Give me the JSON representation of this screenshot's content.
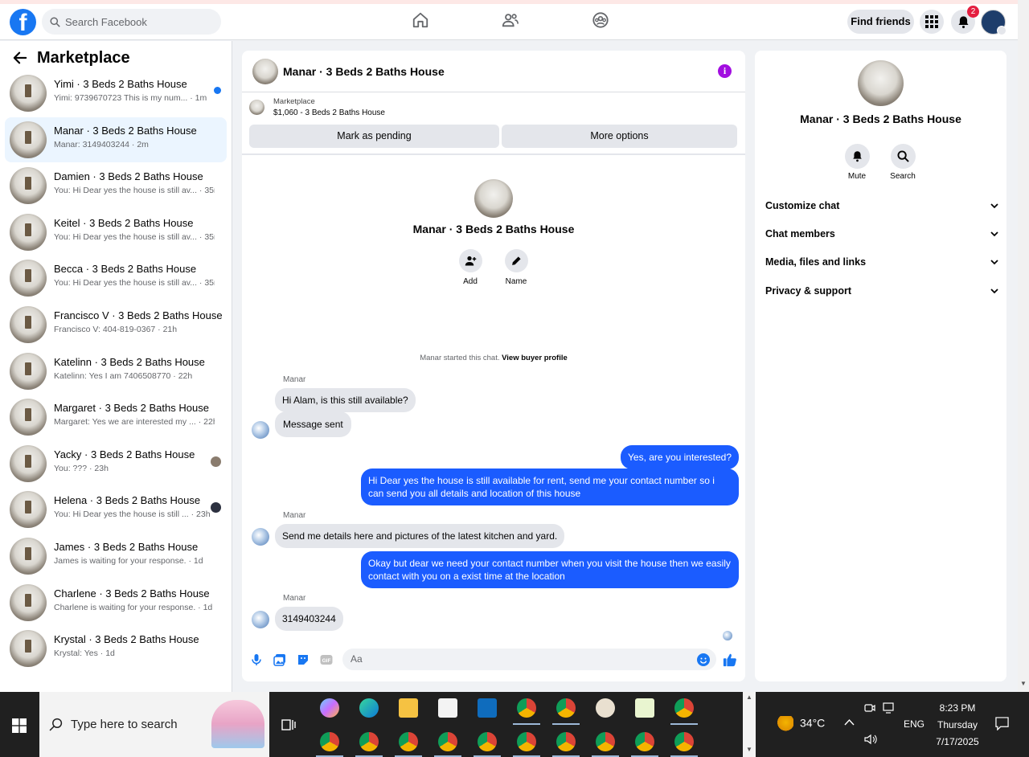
{
  "topbar": {
    "logo_letter": "f",
    "search_placeholder": "Search Facebook",
    "find_friends": "Find friends",
    "notification_count": "2"
  },
  "sidebar": {
    "title": "Marketplace",
    "conversations": [
      {
        "name": "Yimi · 3 Beds 2 Baths House",
        "preview": "Yimi: 9739670723 This is my num... · 1m",
        "unread": true
      },
      {
        "name": "Manar · 3 Beds 2 Baths House",
        "preview": "Manar: 3149403244 · 2m",
        "active": true
      },
      {
        "name": "Damien · 3 Beds 2 Baths House",
        "preview": "You: Hi Dear yes the house is still av... · 35m"
      },
      {
        "name": "Keitel · 3 Beds 2 Baths House",
        "preview": "You: Hi Dear yes the house is still av... · 35m"
      },
      {
        "name": "Becca · 3 Beds 2 Baths House",
        "preview": "You: Hi Dear yes the house is still av... · 35m"
      },
      {
        "name": "Francisco V · 3 Beds 2 Baths House",
        "preview": "Francisco V: 404-819-0367 · 21h"
      },
      {
        "name": "Katelinn · 3 Beds 2 Baths House",
        "preview": "Katelinn: Yes I am 7406508770 · 22h"
      },
      {
        "name": "Margaret · 3 Beds 2 Baths House",
        "preview": "Margaret: Yes we are interested my ... · 22h"
      },
      {
        "name": "Yacky · 3 Beds 2 Baths House",
        "preview": "You: ??? · 23h"
      },
      {
        "name": "Helena · 3 Beds 2 Baths House",
        "preview": "You: Hi Dear yes the house is still ... · 23h"
      },
      {
        "name": "James · 3 Beds 2 Baths House",
        "preview": "James is waiting for your response. · 1d"
      },
      {
        "name": "Charlene · 3 Beds 2 Baths House",
        "preview": "Charlene is waiting for your response. · 1d"
      },
      {
        "name": "Krystal · 3 Beds 2 Baths House",
        "preview": "Krystal: Yes · 1d"
      }
    ]
  },
  "chat": {
    "title": "Manar · 3 Beds 2 Baths House",
    "listing_source": "Marketplace",
    "listing_price": "$1,060 - 3 Beds 2 Baths House",
    "mark_pending": "Mark as pending",
    "more_options": "More options",
    "profile_name": "Manar · 3 Beds 2 Baths House",
    "add_label": "Add",
    "name_label": "Name",
    "started_text": "Manar started this chat.",
    "view_buyer": "View buyer profile",
    "sender_name": "Manar",
    "messages": [
      {
        "from": "in",
        "text": "Hi Alam, is this still available?"
      },
      {
        "from": "in",
        "text": "Message sent"
      },
      {
        "from": "out",
        "text": "Yes, are you interested?"
      },
      {
        "from": "out",
        "text": "Hi Dear yes the house is still available for rent, send me your contact number so i can send you all details and location of this house"
      },
      {
        "from": "in",
        "text": "Send me details here and pictures of the latest kitchen and yard."
      },
      {
        "from": "out",
        "text": "Okay but dear we need your contact number when you visit the house then we easily contact with you on a exist time at the location"
      },
      {
        "from": "in",
        "text": "3149403244"
      }
    ],
    "composer_placeholder": "Aa"
  },
  "details": {
    "name": "Manar · 3 Beds 2 Baths House",
    "mute": "Mute",
    "search": "Search",
    "sections": [
      "Customize chat",
      "Chat members",
      "Media, files and links",
      "Privacy & support"
    ]
  },
  "taskbar": {
    "search_placeholder": "Type here to search",
    "temperature": "34°C",
    "language": "ENG",
    "time": "8:23 PM",
    "day": "Thursday",
    "date": "7/17/2025"
  },
  "colors": {
    "accent": "#1877f2",
    "outgoing_bubble": "#1b5cff",
    "info": "#a20ee0"
  }
}
